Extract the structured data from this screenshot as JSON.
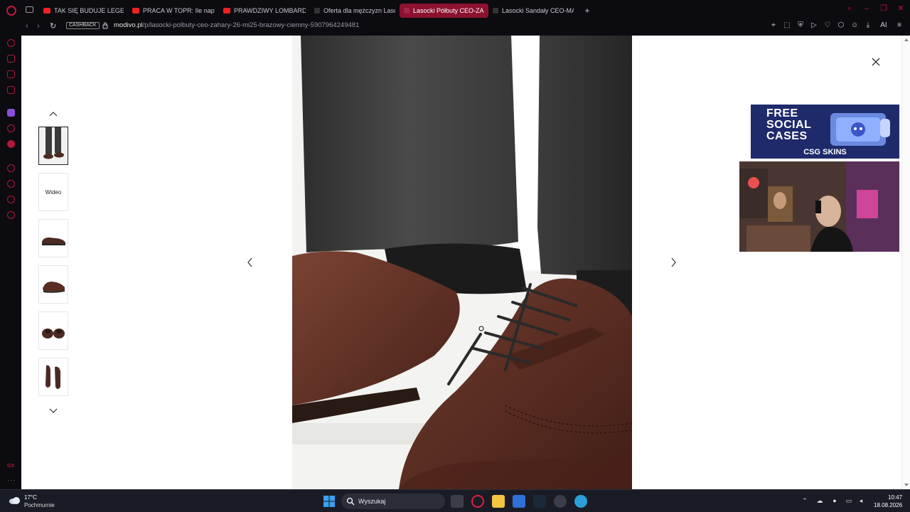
{
  "browser": {
    "tabs": [
      {
        "label": "TAK SIĘ BUDUJE LEGENDE",
        "favicon": "youtube-icon",
        "active": false
      },
      {
        "label": "PRACA W TOPR: Ile napraw",
        "favicon": "youtube-icon",
        "active": false
      },
      {
        "label": "PRAWDZIWY LOMBARD - (",
        "favicon": "youtube-icon",
        "active": false
      },
      {
        "label": "Oferta dla mężczyzn Lasoc",
        "favicon": "modivo-icon",
        "active": false
      },
      {
        "label": "Lasocki Półbuty CEO-ZAHA",
        "favicon": "modivo-icon",
        "active": true
      },
      {
        "label": "Lasocki Sandały CEO-MAR",
        "favicon": "modivo-icon",
        "active": false
      }
    ],
    "new_tab": "+",
    "cashback_label": "CASHBACK",
    "url_host": "modivo.pl",
    "url_path": "/p/lasocki-polbuty-ceo-zahary-26-mi25-brazowy-ciemny-5907964249481",
    "ai_label": "AI",
    "accent_color": "#c2183a"
  },
  "gallery": {
    "video_label": "Wideo",
    "thumbnails": [
      {
        "name": "thumb-1",
        "kind": "legs-photo",
        "selected": true
      },
      {
        "name": "thumb-2",
        "kind": "video",
        "selected": false
      },
      {
        "name": "thumb-3",
        "kind": "side-shoe",
        "selected": false
      },
      {
        "name": "thumb-4",
        "kind": "angle-shoe",
        "selected": false
      },
      {
        "name": "thumb-5",
        "kind": "pair-front",
        "selected": false
      },
      {
        "name": "thumb-6",
        "kind": "pair-top",
        "selected": false
      }
    ]
  },
  "ads": {
    "headline_1": "FREE",
    "headline_2": "SOCIAL",
    "headline_3": "CASES",
    "brand": "CSG SKINS",
    "bg_color": "#1f2a6b"
  },
  "taskbar": {
    "temperature": "17°C",
    "weather": "Pochmurnie",
    "search_label": "Wyszukaj",
    "time": "10:47",
    "date": "18.08.2026"
  }
}
